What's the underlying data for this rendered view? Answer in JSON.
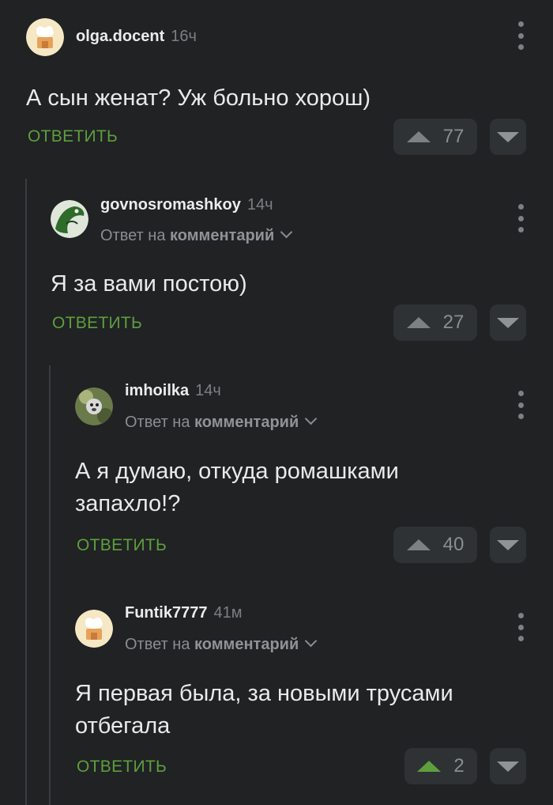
{
  "comments": [
    {
      "username": "olga.docent",
      "time": "16ч",
      "reply_prefix": "",
      "reply_target": "",
      "text": "А сын женат? Уж больно хорош)",
      "reply_label": "ОТВЕТИТЬ",
      "rating": "77",
      "upvoted": false
    },
    {
      "username": "govnosromashkoy",
      "time": "14ч",
      "reply_prefix": "Ответ на",
      "reply_target": "комментарий",
      "text": "Я за вами постою)",
      "reply_label": "ОТВЕТИТЬ",
      "rating": "27",
      "upvoted": false
    },
    {
      "username": "imhoilka",
      "time": "14ч",
      "reply_prefix": "Ответ на",
      "reply_target": "комментарий",
      "text": "А я думаю, откуда ромашками запахло!?",
      "reply_label": "ОТВЕТИТЬ",
      "rating": "40",
      "upvoted": false
    },
    {
      "username": "Funtik7777",
      "time": "41м",
      "reply_prefix": "Ответ на",
      "reply_target": "комментарий",
      "text": "Я первая была, за новыми трусами отбегала",
      "reply_label": "ОТВЕТИТЬ",
      "rating": "2",
      "upvoted": true
    }
  ],
  "colors": {
    "background": "#202224",
    "accent_green": "#5e9f3d",
    "button_bg": "#2f3235"
  },
  "icons": [
    "more-vertical-icon",
    "upvote-icon",
    "downvote-icon",
    "chevron-down-icon"
  ]
}
